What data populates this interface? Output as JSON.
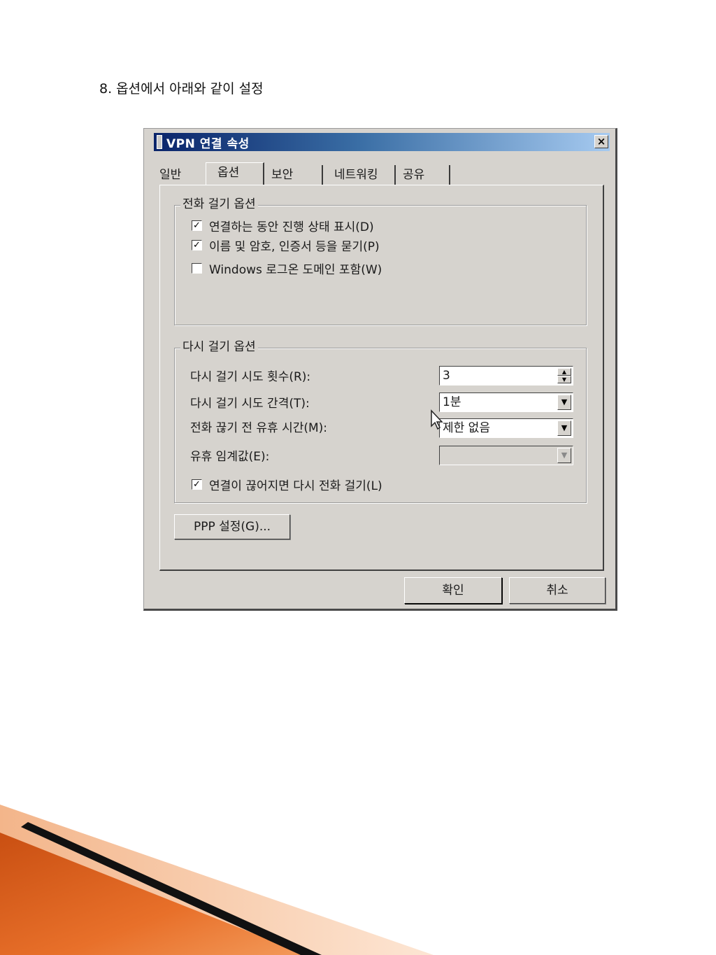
{
  "caption": "8. 옵션에서 아래와 같이 설정",
  "dialog": {
    "title": "VPN 연결 속성",
    "close_glyph": "×",
    "tabs": [
      {
        "label": "일반"
      },
      {
        "label": "옵션",
        "active": true
      },
      {
        "label": "보안"
      },
      {
        "label": "네트워킹"
      },
      {
        "label": "공유"
      }
    ],
    "dialing_options": {
      "legend": "전화 걸기 옵션",
      "items": [
        {
          "label": "연결하는 동안 진행 상태 표시(D)",
          "checked": true
        },
        {
          "label": "이름 및 암호, 인증서 등을 묻기(P)",
          "checked": true
        },
        {
          "label": "Windows 로그온 도메인 포함(W)",
          "checked": false
        }
      ]
    },
    "redial_options": {
      "legend": "다시 걸기 옵션",
      "attempts_label": "다시 걸기 시도 횟수(R):",
      "attempts_value": "3",
      "interval_label": "다시 걸기 시도 간격(T):",
      "interval_value": "1분",
      "idle_label": "전화 끊기 전 유휴 시간(M):",
      "idle_value": "제한 없음",
      "threshold_label": "유휴 임계값(E):",
      "threshold_value": "",
      "redial_label": "연결이 끊어지면 다시 전화 걸기(L)",
      "redial_checked": true
    },
    "ppp_button": "PPP 설정(G)...",
    "ok_button": "확인",
    "cancel_button": "취소",
    "check_glyph": "✓",
    "dropdown_glyph": "▼",
    "spin_up_glyph": "▲",
    "spin_down_glyph": "▼"
  },
  "colors": {
    "dialog_bg": "#d6d3ce",
    "title_start": "#0a246a",
    "title_end": "#a6caf0",
    "deco_orange": "#e8702a",
    "deco_peach": "#f7c9a6",
    "deco_black": "#111111"
  }
}
